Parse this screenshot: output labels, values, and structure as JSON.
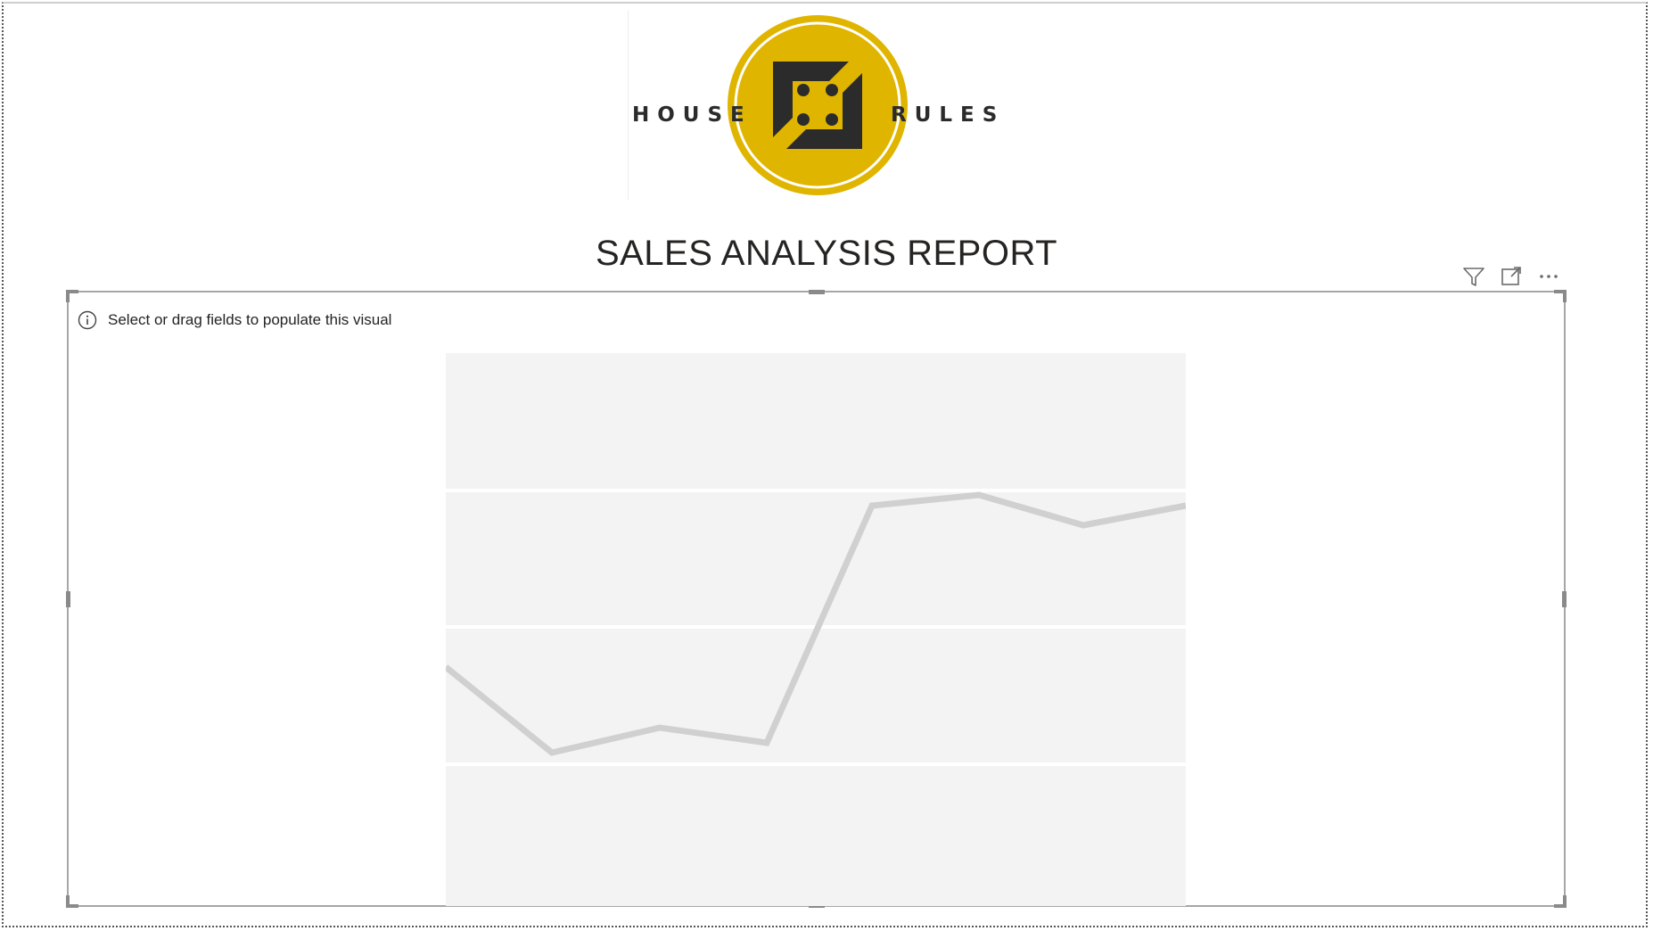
{
  "brand": {
    "word_left": "HOUSE",
    "word_right": "RULES",
    "logo_colors": {
      "gold": "#E0B500",
      "dark": "#2B2B2B",
      "ring": "#FFFFFF"
    }
  },
  "report": {
    "title": "SALES ANALYSIS REPORT"
  },
  "visual_header": {
    "icons": [
      "filter-icon",
      "focus-mode-icon",
      "more-options-icon"
    ]
  },
  "visual": {
    "hint_text": "Select or drag fields to populate this visual",
    "hint_icon": "info-icon",
    "placeholder_colors": {
      "background": "#F3F3F3",
      "gridline": "#FFFFFF",
      "line": "#D0D0D0"
    }
  }
}
